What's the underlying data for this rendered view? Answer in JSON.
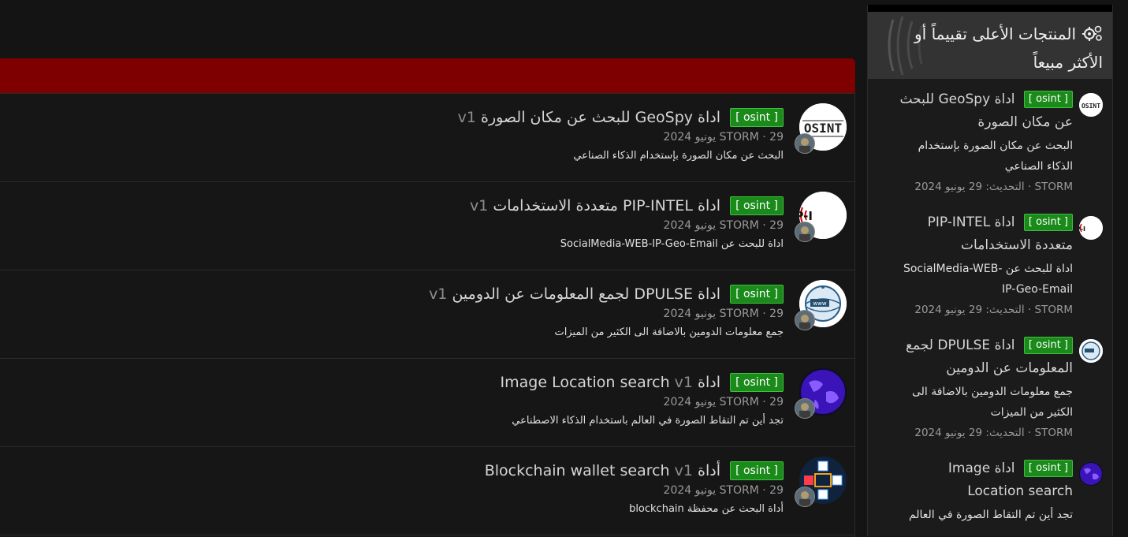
{
  "main": {
    "rows": [
      {
        "badge": "[ osint ]",
        "title": "اداة GeoSpy للبحث عن مكان الصورة",
        "version": "v1",
        "meta": "STORM · 29 يونيو 2024",
        "desc": "البحث عن مكان الصورة بإستخدام الذكاء الصناعي",
        "icon": "osint-logo-icon"
      },
      {
        "badge": "[ osint ]",
        "title": "اداة PIP-INTEL متعددة الاستخدامات",
        "version": "v1",
        "meta": "STORM · 29 يونيو 2024",
        "desc": "اداة للبحث عن SocialMedia-WEB-IP-Geo-Email",
        "icon": "pip-intel-logo-icon"
      },
      {
        "badge": "[ osint ]",
        "title": "اداة DPULSE لجمع المعلومات عن الدومين",
        "version": "v1",
        "meta": "STORM · 29 يونيو 2024",
        "desc": "جمع معلومات الدومين بالاضافة الى الكثير من الميزات",
        "icon": "www-globe-icon"
      },
      {
        "badge": "[ osint ]",
        "title": "اداة Image Location search",
        "version": "v1",
        "meta": "STORM · 29 يونيو 2024",
        "desc": "تجد أين تم التقاط الصورة في العالم باستخدام الذكاء الاصطناعي",
        "icon": "purple-globe-icon"
      },
      {
        "badge": "[ osint ]",
        "title": "أداة Blockchain wallet search",
        "version": "v1",
        "meta": "STORM · 29 يونيو 2024",
        "desc": "أداة البحث عن محفظة blockchain",
        "icon": "blockchain-cubes-icon"
      }
    ]
  },
  "sidebar": {
    "title": "المنتجات الأعلى تقييماً أو الأكثر مبيعاً",
    "items": [
      {
        "badge": "[ osint ]",
        "title": "اداة GeoSpy للبحث عن مكان الصورة",
        "desc": "البحث عن مكان الصورة بإستخدام الذكاء الصناعي",
        "meta": "STORM · التحديث: 29 يونيو 2024"
      },
      {
        "badge": "[ osint ]",
        "title": "اداة PIP-INTEL متعددة الاستخدامات",
        "desc": "اداة للبحث عن SocialMedia-WEB-IP-Geo-Email",
        "meta": "STORM · التحديث: 29 يونيو 2024"
      },
      {
        "badge": "[ osint ]",
        "title": "اداة DPULSE لجمع المعلومات عن الدومين",
        "desc": "جمع معلومات الدومين بالاضافة الى الكثير من الميزات",
        "meta": "STORM · التحديث: 29 يونيو 2024"
      },
      {
        "badge": "[ osint ]",
        "title": "اداة Image Location search",
        "desc": "تجد أين تم التقاط الصورة في العالم",
        "meta": ""
      }
    ]
  },
  "logos": {
    "osint": "OSINT",
    "pip": "PIP-I",
    "www": "www"
  },
  "colors": {
    "accent_red": "#7f0000",
    "badge_green": "#1a8a1a"
  }
}
